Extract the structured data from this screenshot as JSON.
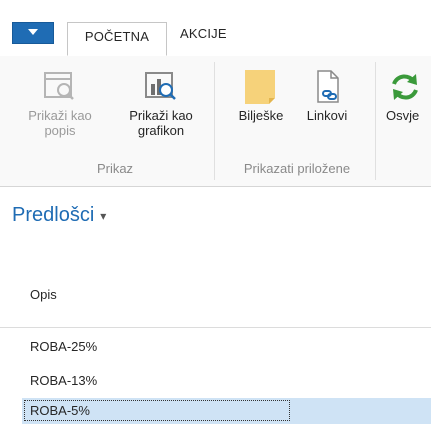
{
  "tabs": {
    "active": "POČETNA",
    "other": "AKCIJE"
  },
  "ribbon": {
    "prikaz": {
      "label": "Prikaz",
      "list_button": {
        "line1": "Prikaži kao",
        "line2": "popis"
      },
      "chart_button": {
        "line1": "Prikaži kao",
        "line2": "grafikon"
      }
    },
    "prilozene": {
      "label": "Prikazati priložene",
      "notes_button": "Bilješke",
      "links_button": "Linkovi"
    },
    "refresh_button": "Osvje"
  },
  "page": {
    "title": "Predlošci",
    "column_header": "Opis"
  },
  "rows": [
    {
      "opis": "ROBA-25%"
    },
    {
      "opis": "ROBA-13%"
    },
    {
      "opis": "ROBA-5%"
    }
  ],
  "colors": {
    "accent": "#1f6cb4",
    "selection": "#cfe3f5",
    "note": "#f6d27a"
  }
}
